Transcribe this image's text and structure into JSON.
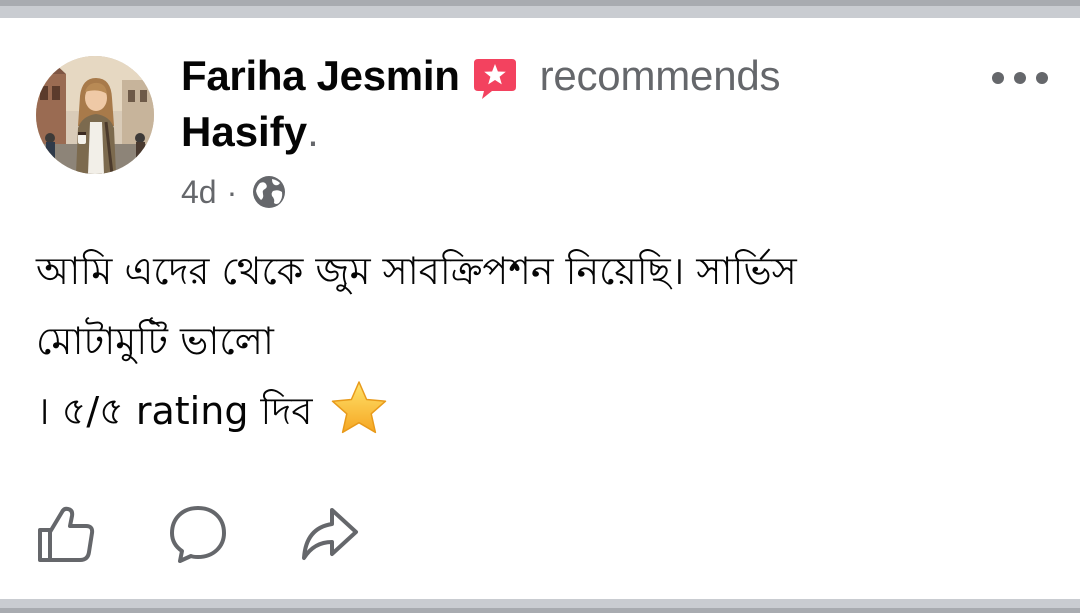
{
  "post": {
    "author": "Fariha Jesmin",
    "verb": "recommends",
    "page_name": "Hasify",
    "period": ".",
    "time": "4d",
    "meta_separator": "·",
    "privacy_icon": "globe-icon",
    "badge_icon": "recommend-star-badge-icon",
    "menu_icon": "more-options-icon",
    "body_lines": [
      "আমি এদের থেকে জুম সাবক্রিপশন নিয়েছি। সার্ভিস",
      "মোটামুটি ভালো",
      "। ৫/৫ rating দিব"
    ],
    "emoji": "star-emoji-icon"
  },
  "actions": [
    {
      "icon": "like-icon"
    },
    {
      "icon": "comment-icon"
    },
    {
      "icon": "share-icon"
    }
  ],
  "colors": {
    "text_primary": "#050505",
    "text_secondary": "#65676b",
    "badge": "#f3425f",
    "separator": "#c9ccd1",
    "star": "#fbc52b"
  }
}
